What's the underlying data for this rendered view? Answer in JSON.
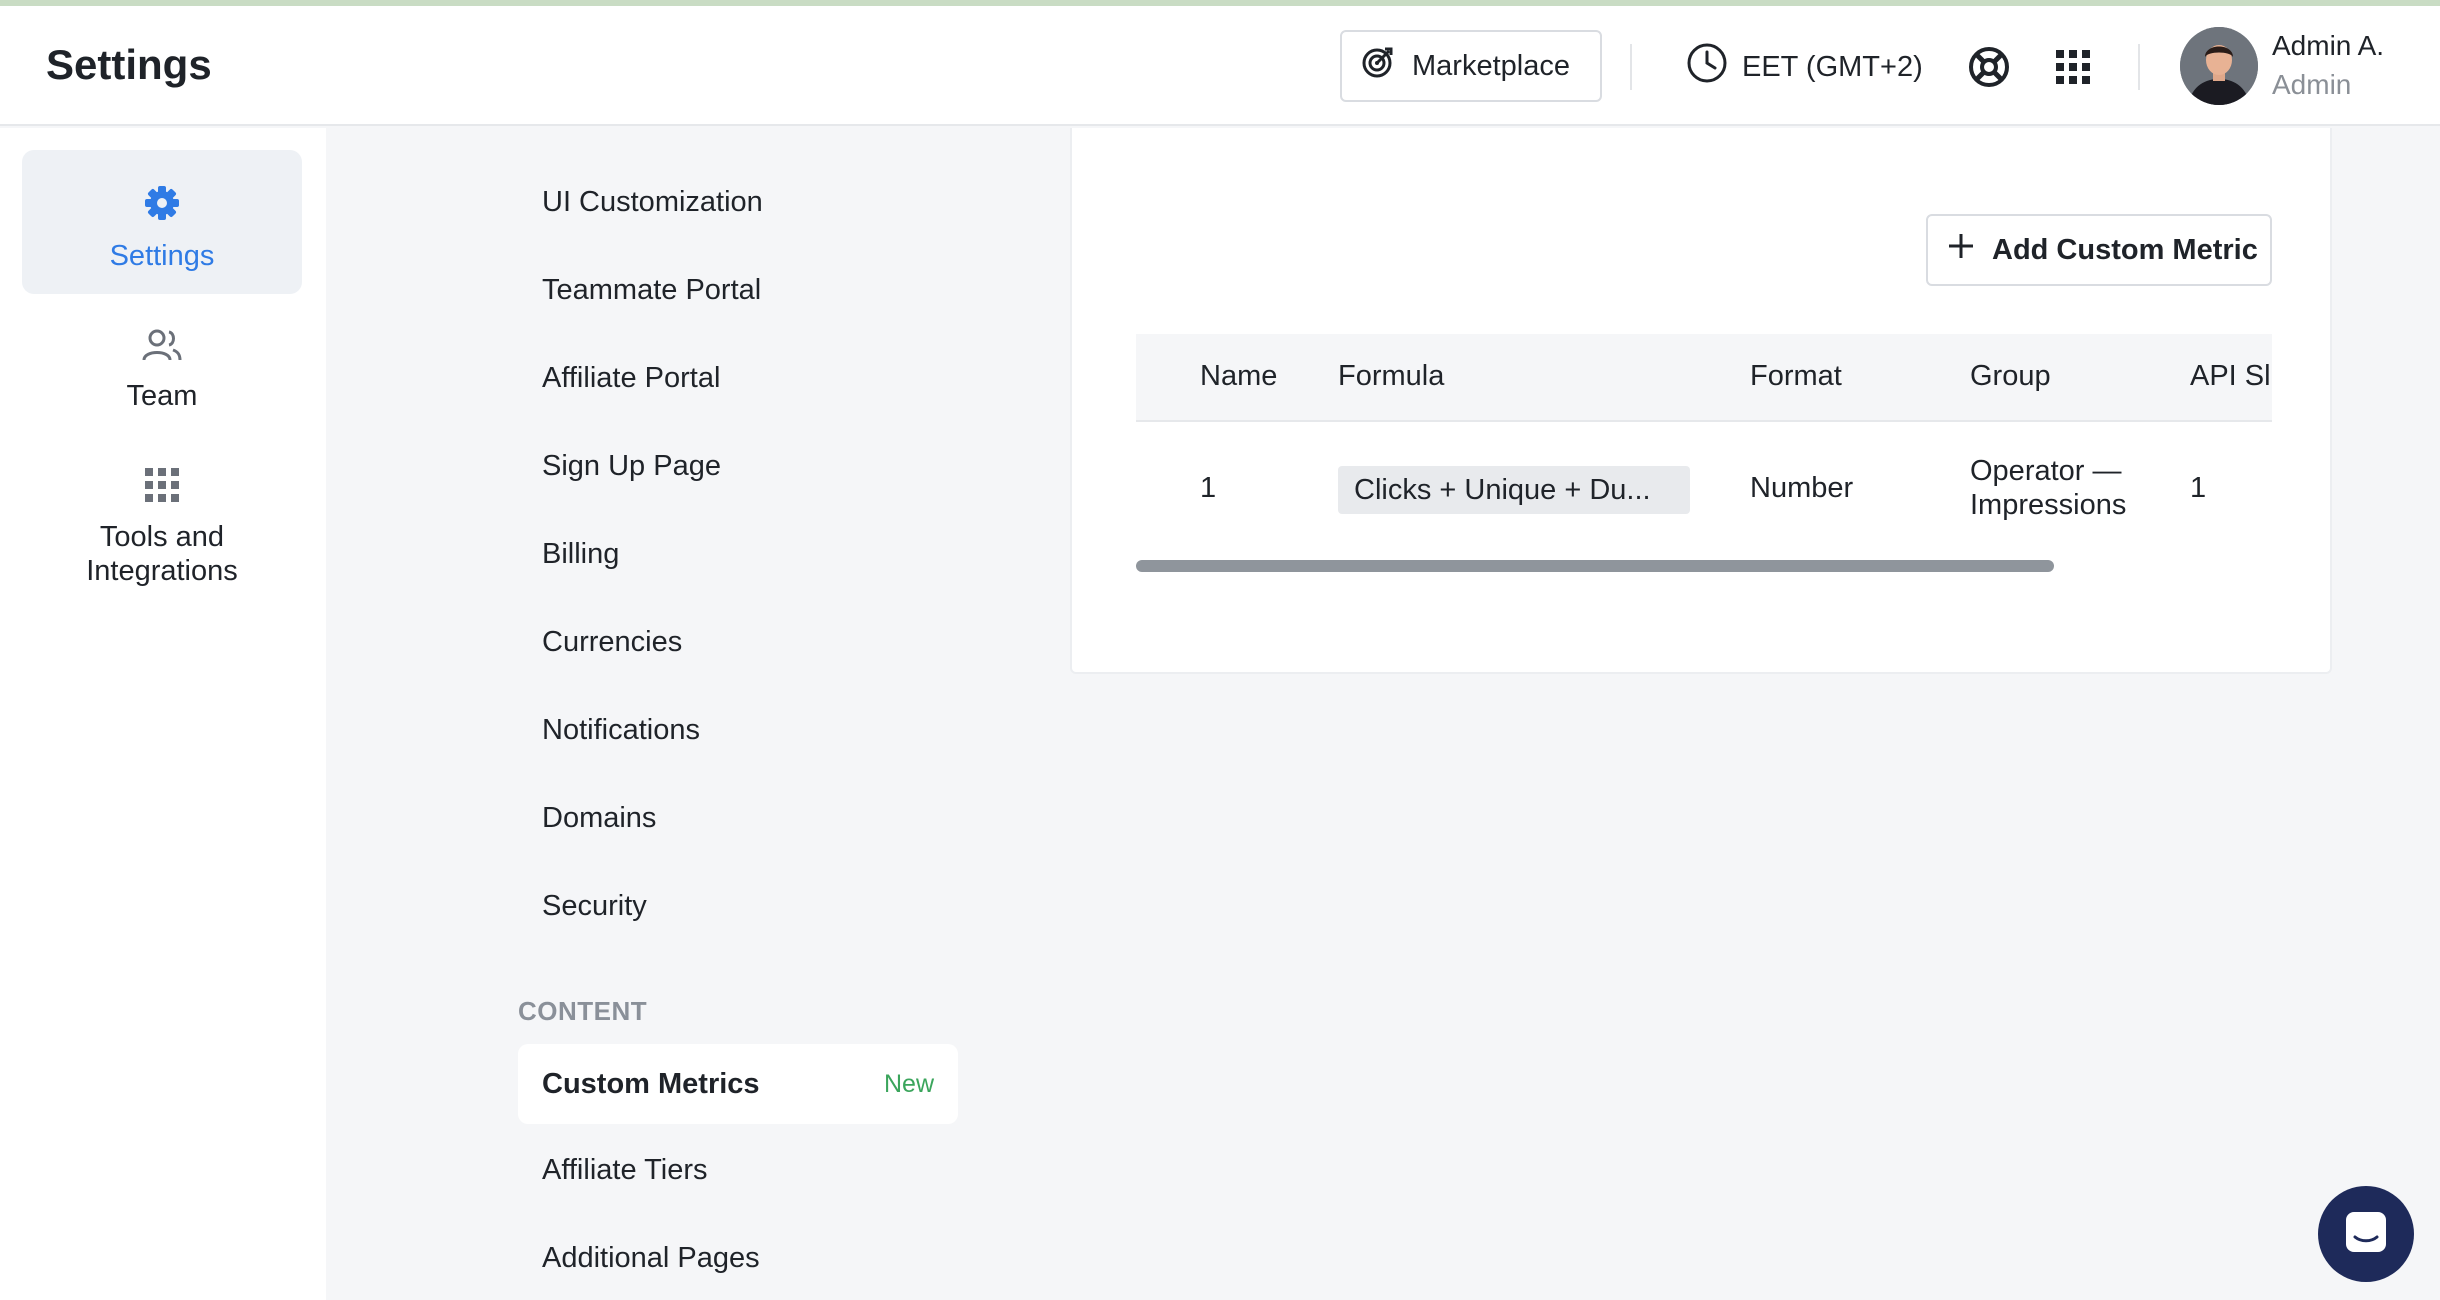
{
  "header": {
    "title": "Settings",
    "marketplace_label": "Marketplace",
    "timezone_label": "EET (GMT+2)",
    "user": {
      "name": "Admin A.",
      "role": "Admin"
    }
  },
  "leftnav": {
    "items": [
      {
        "label": "Settings",
        "icon": "gear-icon",
        "active": true
      },
      {
        "label": "Team",
        "icon": "people-icon",
        "active": false
      },
      {
        "label": "Tools and Integrations",
        "icon": "grid-icon",
        "active": false
      }
    ]
  },
  "subnav": {
    "items": [
      "UI Customization",
      "Teammate Portal",
      "Affiliate Portal",
      "Sign Up Page",
      "Billing",
      "Currencies",
      "Notifications",
      "Domains",
      "Security"
    ],
    "section_label": "CONTENT",
    "active_item": {
      "label": "Custom Metrics",
      "badge": "New"
    },
    "content_items": [
      "Affiliate Tiers",
      "Additional Pages"
    ]
  },
  "main": {
    "add_button_label": "Add Custom Metric",
    "table": {
      "columns": [
        "Name",
        "Formula",
        "Format",
        "Group",
        "API Sl"
      ],
      "rows": [
        {
          "name": "1",
          "formula": "Clicks + Unique + Du...",
          "format": "Number",
          "group_line1": "Operator —",
          "group_line2": "Impressions",
          "api_slug": "1"
        }
      ]
    }
  },
  "colors": {
    "accent": "#2f7be5",
    "badge_green": "#3ba55c",
    "chat_launcher": "#1e2a5a"
  }
}
